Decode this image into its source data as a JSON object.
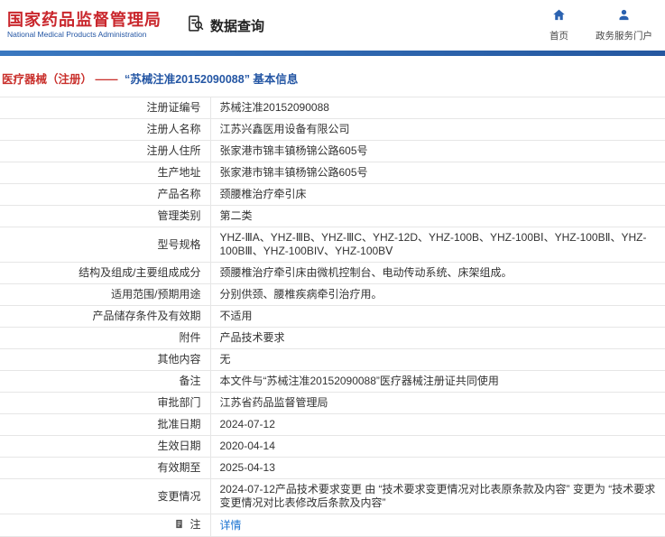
{
  "header": {
    "org_name_cn": "国家药品监督管理局",
    "org_name_en": "National Medical Products Administration",
    "query_label": "数据查询",
    "nav": [
      {
        "label": "首页",
        "icon": "home-icon"
      },
      {
        "label": "政务服务门户",
        "icon": "user-icon"
      }
    ]
  },
  "breadcrumb": {
    "section": "医疗器械（注册） ——",
    "title": "“苏械注准20152090088” 基本信息"
  },
  "table": {
    "rows": [
      {
        "label": "注册证编号",
        "value": "苏械注准20152090088"
      },
      {
        "label": "注册人名称",
        "value": "江苏兴鑫医用设备有限公司"
      },
      {
        "label": "注册人住所",
        "value": "张家港市锦丰镇杨锦公路605号"
      },
      {
        "label": "生产地址",
        "value": "张家港市锦丰镇杨锦公路605号"
      },
      {
        "label": "产品名称",
        "value": "颈腰椎治疗牵引床"
      },
      {
        "label": "管理类别",
        "value": "第二类"
      },
      {
        "label": "型号规格",
        "value": "YHZ-ⅢA、YHZ-ⅢB、YHZ-ⅢC、YHZ-12D、YHZ-100B、YHZ-100BⅠ、YHZ-100BⅡ、YHZ-100BⅢ、YHZ-100BIV、YHZ-100BⅤ"
      },
      {
        "label": "结构及组成/主要组成成分",
        "value": "颈腰椎治疗牵引床由微机控制台、电动传动系统、床架组成。"
      },
      {
        "label": "适用范围/预期用途",
        "value": "分别供颈、腰椎疾病牵引治疗用。"
      },
      {
        "label": "产品储存条件及有效期",
        "value": "不适用"
      },
      {
        "label": "附件",
        "value": "产品技术要求"
      },
      {
        "label": "其他内容",
        "value": "无"
      },
      {
        "label": "备注",
        "value": "本文件与“苏械注准20152090088”医疗器械注册证共同使用"
      },
      {
        "label": "审批部门",
        "value": "江苏省药品监督管理局"
      },
      {
        "label": "批准日期",
        "value": "2024-07-12"
      },
      {
        "label": "生效日期",
        "value": "2020-04-14"
      },
      {
        "label": "有效期至",
        "value": "2025-04-13"
      },
      {
        "label": "变更情况",
        "value": "2024-07-12产品技术要求变更 由 “技术要求变更情况对比表原条款及内容” 变更为 “技术要求变更情况对比表修改后条款及内容”"
      },
      {
        "label": "注",
        "value": "详情"
      }
    ]
  },
  "colors": {
    "brand_red": "#c9262c",
    "brand_blue": "#2456a4",
    "bar_blue": "#2558a0",
    "link_blue": "#1b74d1",
    "border_gray": "#e6e6e6"
  }
}
